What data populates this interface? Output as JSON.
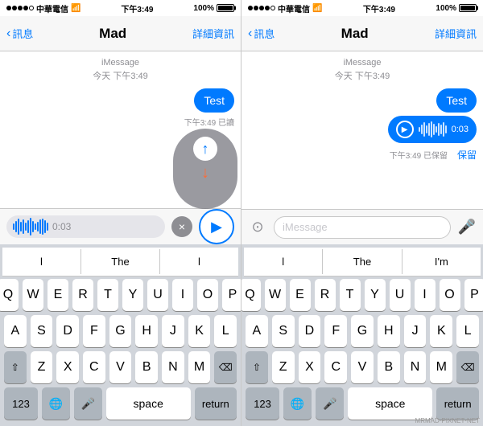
{
  "panel1": {
    "status": {
      "carrier": "中華電信",
      "wifi": "WiFi",
      "time": "下午3:49",
      "battery": "100%"
    },
    "nav": {
      "back_label": "訊息",
      "title": "Mad",
      "detail_label": "詳細資訊"
    },
    "chat": {
      "imessage_label": "iMessage",
      "time_label": "今天 下午3:49",
      "bubble_text": "Test",
      "bubble_meta": "下午3:49 已讀"
    },
    "recording": {
      "duration": "0:03",
      "cancel_icon": "×",
      "play_icon": "▶"
    },
    "slide_up": {
      "up_arrow": "↑"
    },
    "suggestions": [
      "l",
      "The",
      "l"
    ],
    "keyboard": {
      "rows": [
        [
          "Q",
          "W",
          "E",
          "R",
          "T",
          "Y",
          "U",
          "I",
          "O",
          "P"
        ],
        [
          "A",
          "S",
          "D",
          "F",
          "G",
          "H",
          "J",
          "K",
          "L"
        ],
        [
          "Z",
          "X",
          "C",
          "V",
          "B",
          "N",
          "M"
        ],
        [
          "123",
          "emoji",
          "mic",
          "space",
          "return"
        ]
      ]
    }
  },
  "panel2": {
    "status": {
      "carrier": "中華電信",
      "wifi": "WiFi",
      "time": "下午3:49",
      "battery": "100%"
    },
    "nav": {
      "back_label": "訊息",
      "title": "Mad",
      "detail_label": "詳細資訊"
    },
    "chat": {
      "imessage_label": "iMessage",
      "time_label": "今天 下午3:49",
      "bubble_text": "Test",
      "audio_duration": "0:03",
      "audio_meta": "下午3:49 已保留",
      "keep_label": "保留"
    },
    "input": {
      "placeholder": "iMessage",
      "mic_icon": "🎤",
      "camera_icon": "📷"
    },
    "suggestions": [
      "l",
      "The",
      "I'm"
    ],
    "keyboard": {
      "rows": [
        [
          "Q",
          "W",
          "E",
          "R",
          "T",
          "Y",
          "U",
          "I",
          "O",
          "P"
        ],
        [
          "A",
          "S",
          "D",
          "F",
          "G",
          "H",
          "J",
          "K",
          "L"
        ],
        [
          "Z",
          "X",
          "C",
          "V",
          "B",
          "N",
          "M"
        ],
        [
          "123",
          "emoji",
          "mic",
          "space",
          "return"
        ]
      ]
    }
  },
  "watermark": "MRMAD·PIXNET·NET"
}
